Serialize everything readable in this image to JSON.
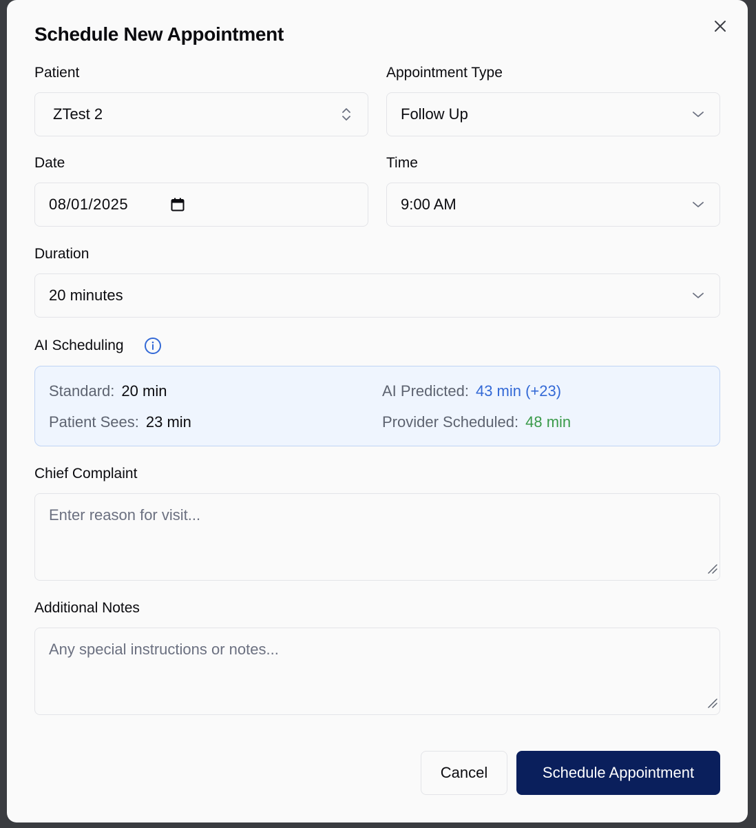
{
  "dialog": {
    "title": "Schedule New Appointment",
    "close_icon": "close-icon"
  },
  "patient": {
    "label": "Patient",
    "value": "ZTest 2",
    "icon": "chevron-up-down-icon"
  },
  "appointment_type": {
    "label": "Appointment Type",
    "value": "Follow Up",
    "icon": "chevron-down-icon"
  },
  "date": {
    "label": "Date",
    "value": "08/01/2025",
    "icon": "calendar-icon"
  },
  "time": {
    "label": "Time",
    "value": "9:00 AM",
    "icon": "chevron-down-icon"
  },
  "duration": {
    "label": "Duration",
    "value": "20 minutes",
    "icon": "chevron-down-icon"
  },
  "ai_scheduling": {
    "label": "AI Scheduling",
    "icon": "info-icon",
    "standard_label": "Standard:",
    "standard_value": "20 min",
    "predicted_label": "AI Predicted:",
    "predicted_value": "43 min (+23)",
    "patient_sees_label": "Patient Sees:",
    "patient_sees_value": "23 min",
    "provider_label": "Provider Scheduled:",
    "provider_value": "48 min",
    "colors": {
      "predicted": "#3369d6",
      "provider": "#3a9a4a",
      "box_background": "#eff5fe",
      "box_border": "#bfd3f4"
    }
  },
  "chief_complaint": {
    "label": "Chief Complaint",
    "placeholder": "Enter reason for visit..."
  },
  "additional_notes": {
    "label": "Additional Notes",
    "placeholder": "Any special instructions or notes..."
  },
  "actions": {
    "cancel_label": "Cancel",
    "submit_label": "Schedule Appointment",
    "primary_color": "#0a1f5c"
  }
}
